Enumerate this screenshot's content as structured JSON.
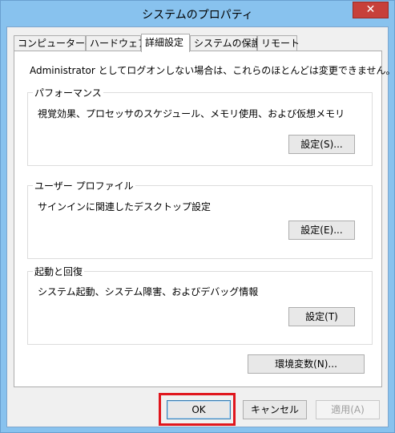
{
  "window": {
    "title": "システムのプロパティ",
    "close_glyph": "✕"
  },
  "tabs": [
    {
      "label": "コンピューター名",
      "active": false
    },
    {
      "label": "ハードウェア",
      "active": false
    },
    {
      "label": "詳細設定",
      "active": true
    },
    {
      "label": "システムの保護",
      "active": false
    },
    {
      "label": "リモート",
      "active": false
    }
  ],
  "main": {
    "header_text": "Administrator としてログオンしない場合は、これらのほとんどは変更できません。",
    "performance": {
      "title": "パフォーマンス",
      "description": "視覚効果、プロセッサのスケジュール、メモリ使用、および仮想メモリ",
      "button_label": "設定(S)..."
    },
    "user_profile": {
      "title": "ユーザー プロファイル",
      "description": "サインインに関連したデスクトップ設定",
      "button_label": "設定(E)..."
    },
    "startup_recovery": {
      "title": "起動と回復",
      "description": "システム起動、システム障害、およびデバッグ情報",
      "button_label": "設定(T)"
    },
    "env_button_label": "環境変数(N)..."
  },
  "footer": {
    "ok_label": "OK",
    "cancel_label": "キャンセル",
    "apply_label": "適用(A)"
  },
  "colors": {
    "title_bar": "#88c2ee",
    "close_button": "#c7403a",
    "highlight": "#e0161d"
  }
}
